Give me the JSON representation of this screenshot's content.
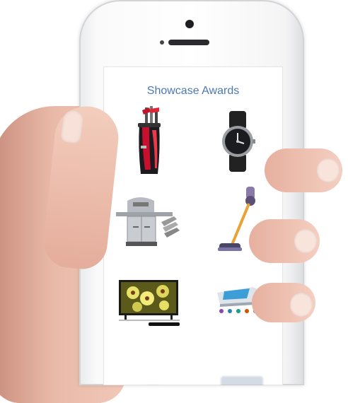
{
  "screen": {
    "title": "Showcase Awards",
    "products": [
      {
        "name": "golf-bag-icon"
      },
      {
        "name": "wristwatch-icon"
      },
      {
        "name": "gas-grill-icon"
      },
      {
        "name": "stick-vacuum-icon"
      },
      {
        "name": "television-icon"
      },
      {
        "name": "device-with-color-dots-icon"
      },
      {
        "name": "partially-visible-product-icon"
      },
      {
        "name": "partially-visible-product-icon"
      }
    ]
  },
  "colors": {
    "title": "#4c78b9",
    "phone_body": "#f7f7f7",
    "skin": "#f1c8b8"
  }
}
